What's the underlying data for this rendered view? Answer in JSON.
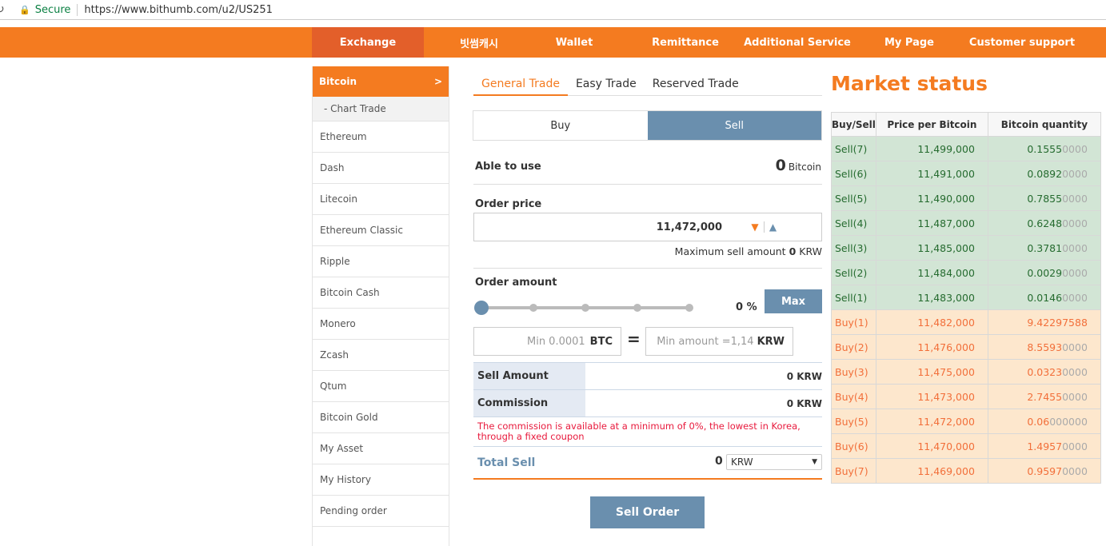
{
  "browser": {
    "secure": "Secure",
    "url": "https://www.bithumb.com/u2/US251"
  },
  "nav": [
    "Exchange",
    "빗썸캐시",
    "Wallet",
    "Remittance",
    "Additional Service",
    "My Page",
    "Customer support"
  ],
  "sidebar": {
    "header": "Bitcoin",
    "header_arrow": ">",
    "sub": "- Chart Trade",
    "items": [
      "Ethereum",
      "Dash",
      "Litecoin",
      "Ethereum Classic",
      "Ripple",
      "Bitcoin Cash",
      "Monero",
      "Zcash",
      "Qtum",
      "Bitcoin Gold",
      "My Asset",
      "My History",
      "Pending order"
    ]
  },
  "tabs": [
    "General Trade",
    "Easy Trade",
    "Reserved Trade"
  ],
  "buysell": {
    "buy": "Buy",
    "sell": "Sell"
  },
  "able": {
    "label": "Able to use",
    "value": "0",
    "unit": "Bitcoin"
  },
  "order_price": {
    "label": "Order price",
    "value": "11,472,000",
    "max_label": "Maximum sell amount",
    "max_value": "0",
    "max_unit": "KRW"
  },
  "order_amount": {
    "label": "Order amount",
    "percent": "0 %",
    "percent_value": 0,
    "max_button": "Max",
    "btc_placeholder": "Min 0.0001",
    "btc_unit": "BTC",
    "equals": "=",
    "krw_placeholder": "Min amount =1,14",
    "krw_unit": "KRW"
  },
  "summary": {
    "sell_amount_label": "Sell Amount",
    "sell_amount": "0 KRW",
    "commission_label": "Commission",
    "commission": "0 KRW",
    "notice": "The commission is available at a minimum of 0%, the lowest in Korea, through a fixed coupon",
    "total_label": "Total Sell",
    "total": "0",
    "currency": "KRW",
    "order_button": "Sell Order"
  },
  "market": {
    "title": "Market status",
    "headers": [
      "Buy/Sell",
      "Price per Bitcoin",
      "Bitcoin quantity"
    ],
    "sell": [
      [
        "Sell(7)",
        "11,499,000",
        "0.1555",
        "0000"
      ],
      [
        "Sell(6)",
        "11,491,000",
        "0.0892",
        "0000"
      ],
      [
        "Sell(5)",
        "11,490,000",
        "0.7855",
        "0000"
      ],
      [
        "Sell(4)",
        "11,487,000",
        "0.6248",
        "0000"
      ],
      [
        "Sell(3)",
        "11,485,000",
        "0.3781",
        "0000"
      ],
      [
        "Sell(2)",
        "11,484,000",
        "0.0029",
        "0000"
      ],
      [
        "Sell(1)",
        "11,483,000",
        "0.0146",
        "0000"
      ]
    ],
    "buy": [
      [
        "Buy(1)",
        "11,482,000",
        "9.42297588",
        ""
      ],
      [
        "Buy(2)",
        "11,476,000",
        "8.5593",
        "0000"
      ],
      [
        "Buy(3)",
        "11,475,000",
        "0.0323",
        "0000"
      ],
      [
        "Buy(4)",
        "11,473,000",
        "2.7455",
        "0000"
      ],
      [
        "Buy(5)",
        "11,472,000",
        "0.06",
        "000000"
      ],
      [
        "Buy(6)",
        "11,470,000",
        "1.4957",
        "0000"
      ],
      [
        "Buy(7)",
        "11,469,000",
        "0.9597",
        "0000"
      ]
    ]
  },
  "colors": {
    "brand": "#f47b20",
    "accent": "#6a8fae"
  }
}
